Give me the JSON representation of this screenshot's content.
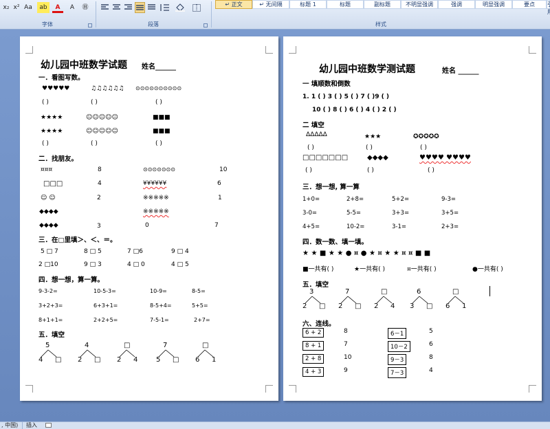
{
  "ribbon": {
    "font_group": {
      "label": "字体",
      "sub": "x₂",
      "sup": "x²",
      "aa": "Aa",
      "highlight": "ab",
      "fontcolor": "A",
      "grow": "A",
      "circle": "㊐"
    },
    "para_group": {
      "label": "段落"
    },
    "styles_group": {
      "label": "样式",
      "items": [
        "↵ 正文",
        "↵ 无间隔",
        "标题 1",
        "标题",
        "副标题",
        "不明显强调",
        "强调",
        "明显强调",
        "要点",
        "引用"
      ]
    }
  },
  "page1": {
    "title": "幼儿园中班数学试题",
    "name_label": "姓名______",
    "s1": {
      "heading": "一．看图写数。",
      "r1": [
        "♥♥♥♥♥",
        "♫♫♫♫♫♫",
        "⊙⊙⊙⊙⊙⊙⊙⊙⊙⊙"
      ],
      "blank": "(        )",
      "r2": [
        "★★★★",
        "☺☺☺☺☺",
        "■■■"
      ],
      "r3": [
        "★★★★",
        "☺☺☺☺☺",
        "■■■"
      ]
    },
    "s2": {
      "heading": "二．找朋友。",
      "left": [
        "¤¤¤",
        "□□□",
        "☺ ☺",
        "◆◆◆◆",
        "◆◆◆◆"
      ],
      "mid": [
        "8",
        "4",
        "2",
        "3"
      ],
      "right": [
        "⊙⊙⊙⊙⊙⊙⊙",
        "¥¥¥¥¥¥",
        "※※※※※",
        "※※※※※",
        "0"
      ],
      "far": [
        "10",
        "6",
        "1",
        "7"
      ]
    },
    "s3": {
      "heading": "三．在□里填＞、＜、＝。",
      "r1": [
        "5 □ 7",
        "8 □ 5",
        "7 □6",
        "9 □ 4"
      ],
      "r2": [
        "2 □10",
        "9 □ 3",
        "4 □  0",
        "4 □ 5"
      ]
    },
    "s4": {
      "heading": "四．想一想，算一算。",
      "r1": [
        "9-3-2=",
        "10-5-3=",
        "10-9=",
        "8-5="
      ],
      "r2": [
        "3+2+3=",
        "6+3+1=",
        "8-5+4=",
        "5+5="
      ],
      "r3": [
        "8+1+1=",
        "2+2+5=",
        "7-5-1=",
        "2+7="
      ]
    },
    "s5": {
      "heading": "五．填空",
      "trees": [
        {
          "top": "5",
          "left": "4",
          "right": "□"
        },
        {
          "top": "4",
          "left": "2",
          "right": "□"
        },
        {
          "top": "□",
          "left": "2",
          "right": "4"
        },
        {
          "top": "7",
          "left": "5",
          "right": "□"
        },
        {
          "top": "□",
          "left": "6",
          "right": "1"
        }
      ]
    }
  },
  "page2": {
    "title": "幼儿园中班数学测试题",
    "name_label": "姓名 ______",
    "s1": {
      "heading": "一 填顺数和倒数",
      "r1": "1. 1  (   )  3  (   )   5  (   )   7  (   )9  (   )",
      "r2": "10  (   )  8  (   )  6  (   )  4  (   )  2  (   )"
    },
    "s2": {
      "heading": "二  填空",
      "g1": [
        "ΔΔΔΔΔ",
        "★★★",
        "✪✪✪✪✪"
      ],
      "blank": "(      )",
      "g2": [
        "□□□□□□□",
        "◆◆◆◆",
        "♥♥♥♥ ♥♥♥♥"
      ]
    },
    "s3": {
      "heading": "三．想一想, 算一算",
      "r1": [
        "1+0=",
        "2+8=",
        "5+2=",
        "9-3="
      ],
      "r2": [
        "3-0=",
        "5-5=",
        "3+3=",
        "3+5="
      ],
      "r3": [
        "4+5=",
        "10-2=",
        "3-1=",
        "2+3="
      ]
    },
    "s4": {
      "heading": "四．数一数、填一填。",
      "symbols": "★ ★ ■ ★ ★ ● ¤ ● ★ ¤   ★ ★   ¤ ¤   ■ ■",
      "answers": [
        "■一共有(      )",
        "★一共有(      )",
        "¤一共有(      )",
        "●一共有(      )"
      ]
    },
    "s5": {
      "heading": "五．填空",
      "trees": [
        {
          "top": "3",
          "left": "2",
          "right": "□"
        },
        {
          "top": "7",
          "left": "2",
          "right": "□"
        },
        {
          "top": "□",
          "left": "2",
          "right": "4"
        },
        {
          "top": "6",
          "left": "3",
          "right": "□"
        },
        {
          "top": "□",
          "left": "6",
          "right": "1"
        }
      ]
    },
    "s6": {
      "heading": "六、连线。",
      "left": [
        "6 + 2",
        "8 + 1",
        "2 + 8",
        "4 + 3"
      ],
      "left_ans": [
        "8",
        "7",
        "10",
        "9"
      ],
      "mid": [
        "6－1",
        "10－2",
        "9－3",
        "7－3"
      ],
      "mid_ans": [
        "5",
        "6",
        "8",
        "4"
      ]
    }
  },
  "status": {
    "lang": ", 中国)",
    "insert": "插入"
  }
}
